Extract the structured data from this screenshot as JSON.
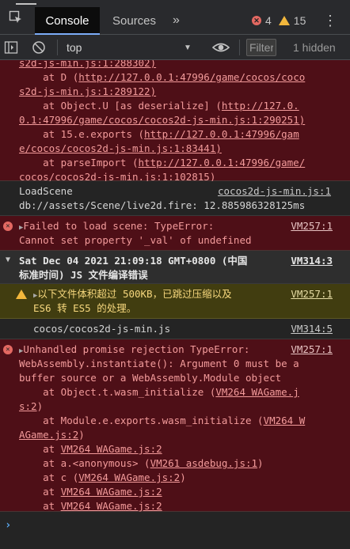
{
  "tabs": {
    "console": "Console",
    "sources": "Sources",
    "more": "»"
  },
  "counts": {
    "errors": "4",
    "warnings": "15"
  },
  "toolbar": {
    "context": "top",
    "filter_placeholder": "Filter",
    "hidden": "1 hidden"
  },
  "entry1": {
    "lines": [
      "s2d-js-min.js:1:288302)",
      "    at D (",
      "s2d-js-min.js:1:289122)",
      "    at Object.U [as deserialize] (",
      "0.1:47996/game/cocos/cocos2d-js-min.js:1:290251)",
      "    at 15.e.exports (",
      "e/cocos/cocos2d-js-min.js:1:83441)",
      "    at parseImport (",
      "cocos/cocos2d-js-min.js:1:102815)"
    ],
    "links": {
      "l1": "http://127.0.0.1:47996/game/cocos/coco",
      "l3": "http://127.0.",
      "l5": "http://127.0.0.1:47996/gam",
      "l7": "http://127.0.0.1:47996/game/"
    }
  },
  "entry2": {
    "line1": "LoadScene",
    "line2": "db://assets/Scene/live2d.fire: 12.885986328125ms",
    "source": "cocos2d-js-min.js:1"
  },
  "entry3": {
    "line1": "Failed to load scene: TypeError:",
    "line2": "Cannot set property '_val' of undefined",
    "source": "VM257:1"
  },
  "entry4": {
    "line1": "Sat Dec 04 2021 21:09:18 GMT+0800 (中国",
    "line2": "标准时间) JS 文件编译错误",
    "source": "VM314:3"
  },
  "entry5": {
    "line1": "以下文件体积超过 500KB，已跳过压缩以及",
    "line2": "ES6 转 ES5 的处理。",
    "source": "VM257:1"
  },
  "entry6": {
    "line1": "cocos/cocos2d-js-min.js",
    "source": "VM314:5"
  },
  "entry7": {
    "line1": "Unhandled promise rejection TypeError:",
    "source": "VM257:1",
    "line2": "WebAssembly.instantiate(): Argument 0 must be a",
    "line3": "buffer source or a WebAssembly.Module object",
    "line4a": "    at Object.t.wasm_initialize (",
    "line4link": "VM264 WAGame.j",
    "line5link": "s:2",
    "line6a": "    at Module.e.exports.wasm_initialize (",
    "line6link": "VM264 W",
    "line7link": "AGame.js:2",
    "line8a": "    at ",
    "line8link": "VM264 WAGame.js:2",
    "line9a": "    at a.<anonymous> (",
    "line9link": "VM261 asdebug.js:1",
    "line10a": "    at c (",
    "line10link": "VM264 WAGame.js:2",
    "line11a": "    at ",
    "line11link": "VM264 WAGame.js:2",
    "line12a": "    at ",
    "line12link": "VM264 WAGame.js:2"
  },
  "prompt": {
    "caret": "›"
  }
}
